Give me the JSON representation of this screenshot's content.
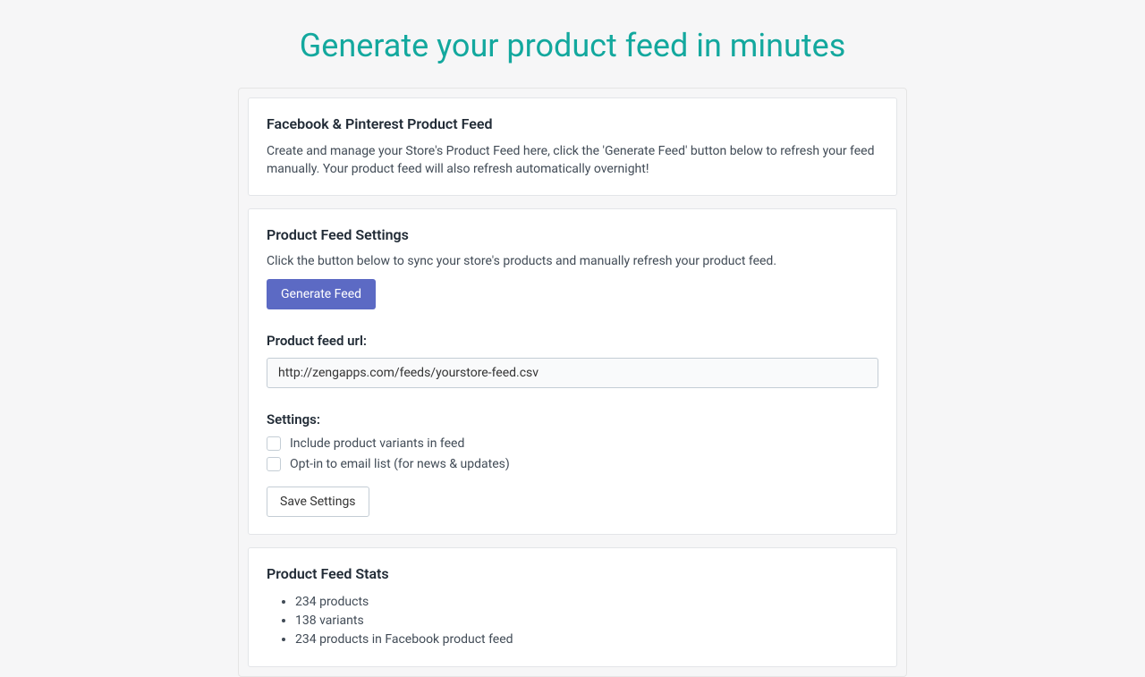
{
  "header": {
    "title": "Generate your product feed in minutes"
  },
  "intro": {
    "title": "Facebook & Pinterest Product Feed",
    "text": "Create and manage your Store's Product Feed here, click the 'Generate Feed' button below to refresh your feed manually. Your product feed will also refresh automatically overnight!"
  },
  "settings": {
    "title": "Product Feed Settings",
    "description": "Click the button below to sync your store's products and manually refresh your product feed.",
    "generate_button": "Generate Feed",
    "url_label": "Product feed url:",
    "url_value": "http://zengapps.com/feeds/yourstore-feed.csv",
    "settings_label": "Settings:",
    "checkboxes": [
      {
        "label": "Include product variants in feed"
      },
      {
        "label": "Opt-in to email list (for news & updates)"
      }
    ],
    "save_button": "Save Settings"
  },
  "stats": {
    "title": "Product Feed Stats",
    "items": [
      "234 products",
      "138 variants",
      "234 products in Facebook product feed"
    ]
  }
}
